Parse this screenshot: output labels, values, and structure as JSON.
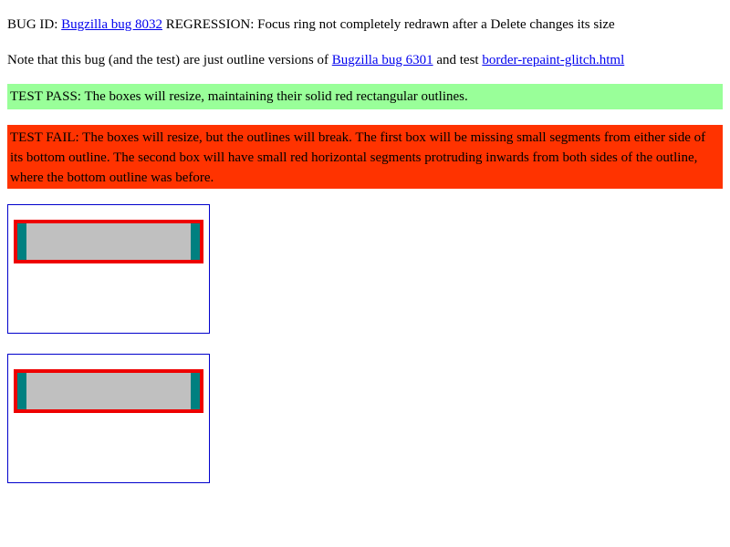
{
  "header": {
    "bug_prefix": "BUG ID:",
    "bug_link": "Bugzilla bug 8032",
    "bug_title": "REGRESSION: Focus ring not completely redrawn after a Delete changes its size"
  },
  "note": {
    "prefix": "Note that this bug (and the test) are just outline versions of",
    "link1": "Bugzilla bug 6301",
    "middle": "and test",
    "link2": "border-repaint-glitch.html"
  },
  "pass_banner": {
    "text": "TEST PASS: The boxes will resize, maintaining their solid red rectangular outlines.",
    "color": "#99ff99"
  },
  "fail_banner": {
    "text": "TEST FAIL: The boxes will resize, but the outlines will break. The first box will be missing small segments from either side of its bottom outline. The second box will have small red horizontal segments protruding inwards from both sides of the outline, where the bottom outline was before.",
    "color": "#ff3300"
  },
  "colors": {
    "link": "#0000ee",
    "outline": "#ee0000",
    "frame_border": "#0000cc",
    "box_side": "#008080",
    "box_fill": "#c0c0c0"
  }
}
